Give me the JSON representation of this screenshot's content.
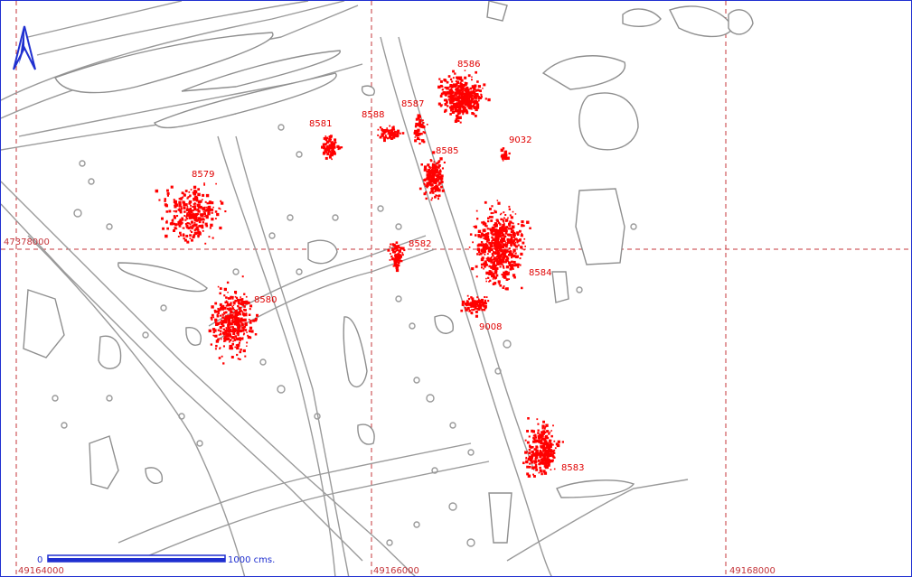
{
  "map": {
    "grid": {
      "x_labels": [
        "49164000",
        "49166000",
        "49168000"
      ],
      "y_labels": [
        "47378000"
      ]
    },
    "scale_bar": {
      "start_label": "0",
      "end_label": "1000 cms."
    },
    "north_arrow": {
      "icon": "north-arrow-icon"
    },
    "clusters": [
      {
        "id": "8586"
      },
      {
        "id": "8588"
      },
      {
        "id": "8587"
      },
      {
        "id": "8581"
      },
      {
        "id": "8585"
      },
      {
        "id": "9032"
      },
      {
        "id": "8579"
      },
      {
        "id": "8582"
      },
      {
        "id": "8584"
      },
      {
        "id": "8580"
      },
      {
        "id": "9008"
      },
      {
        "id": "8583"
      }
    ],
    "colors": {
      "points": "#ff0000",
      "labels": "#e00000",
      "grid": "#c4343a",
      "features": "#9a9a9a",
      "scale": "#1f2fd0"
    }
  }
}
